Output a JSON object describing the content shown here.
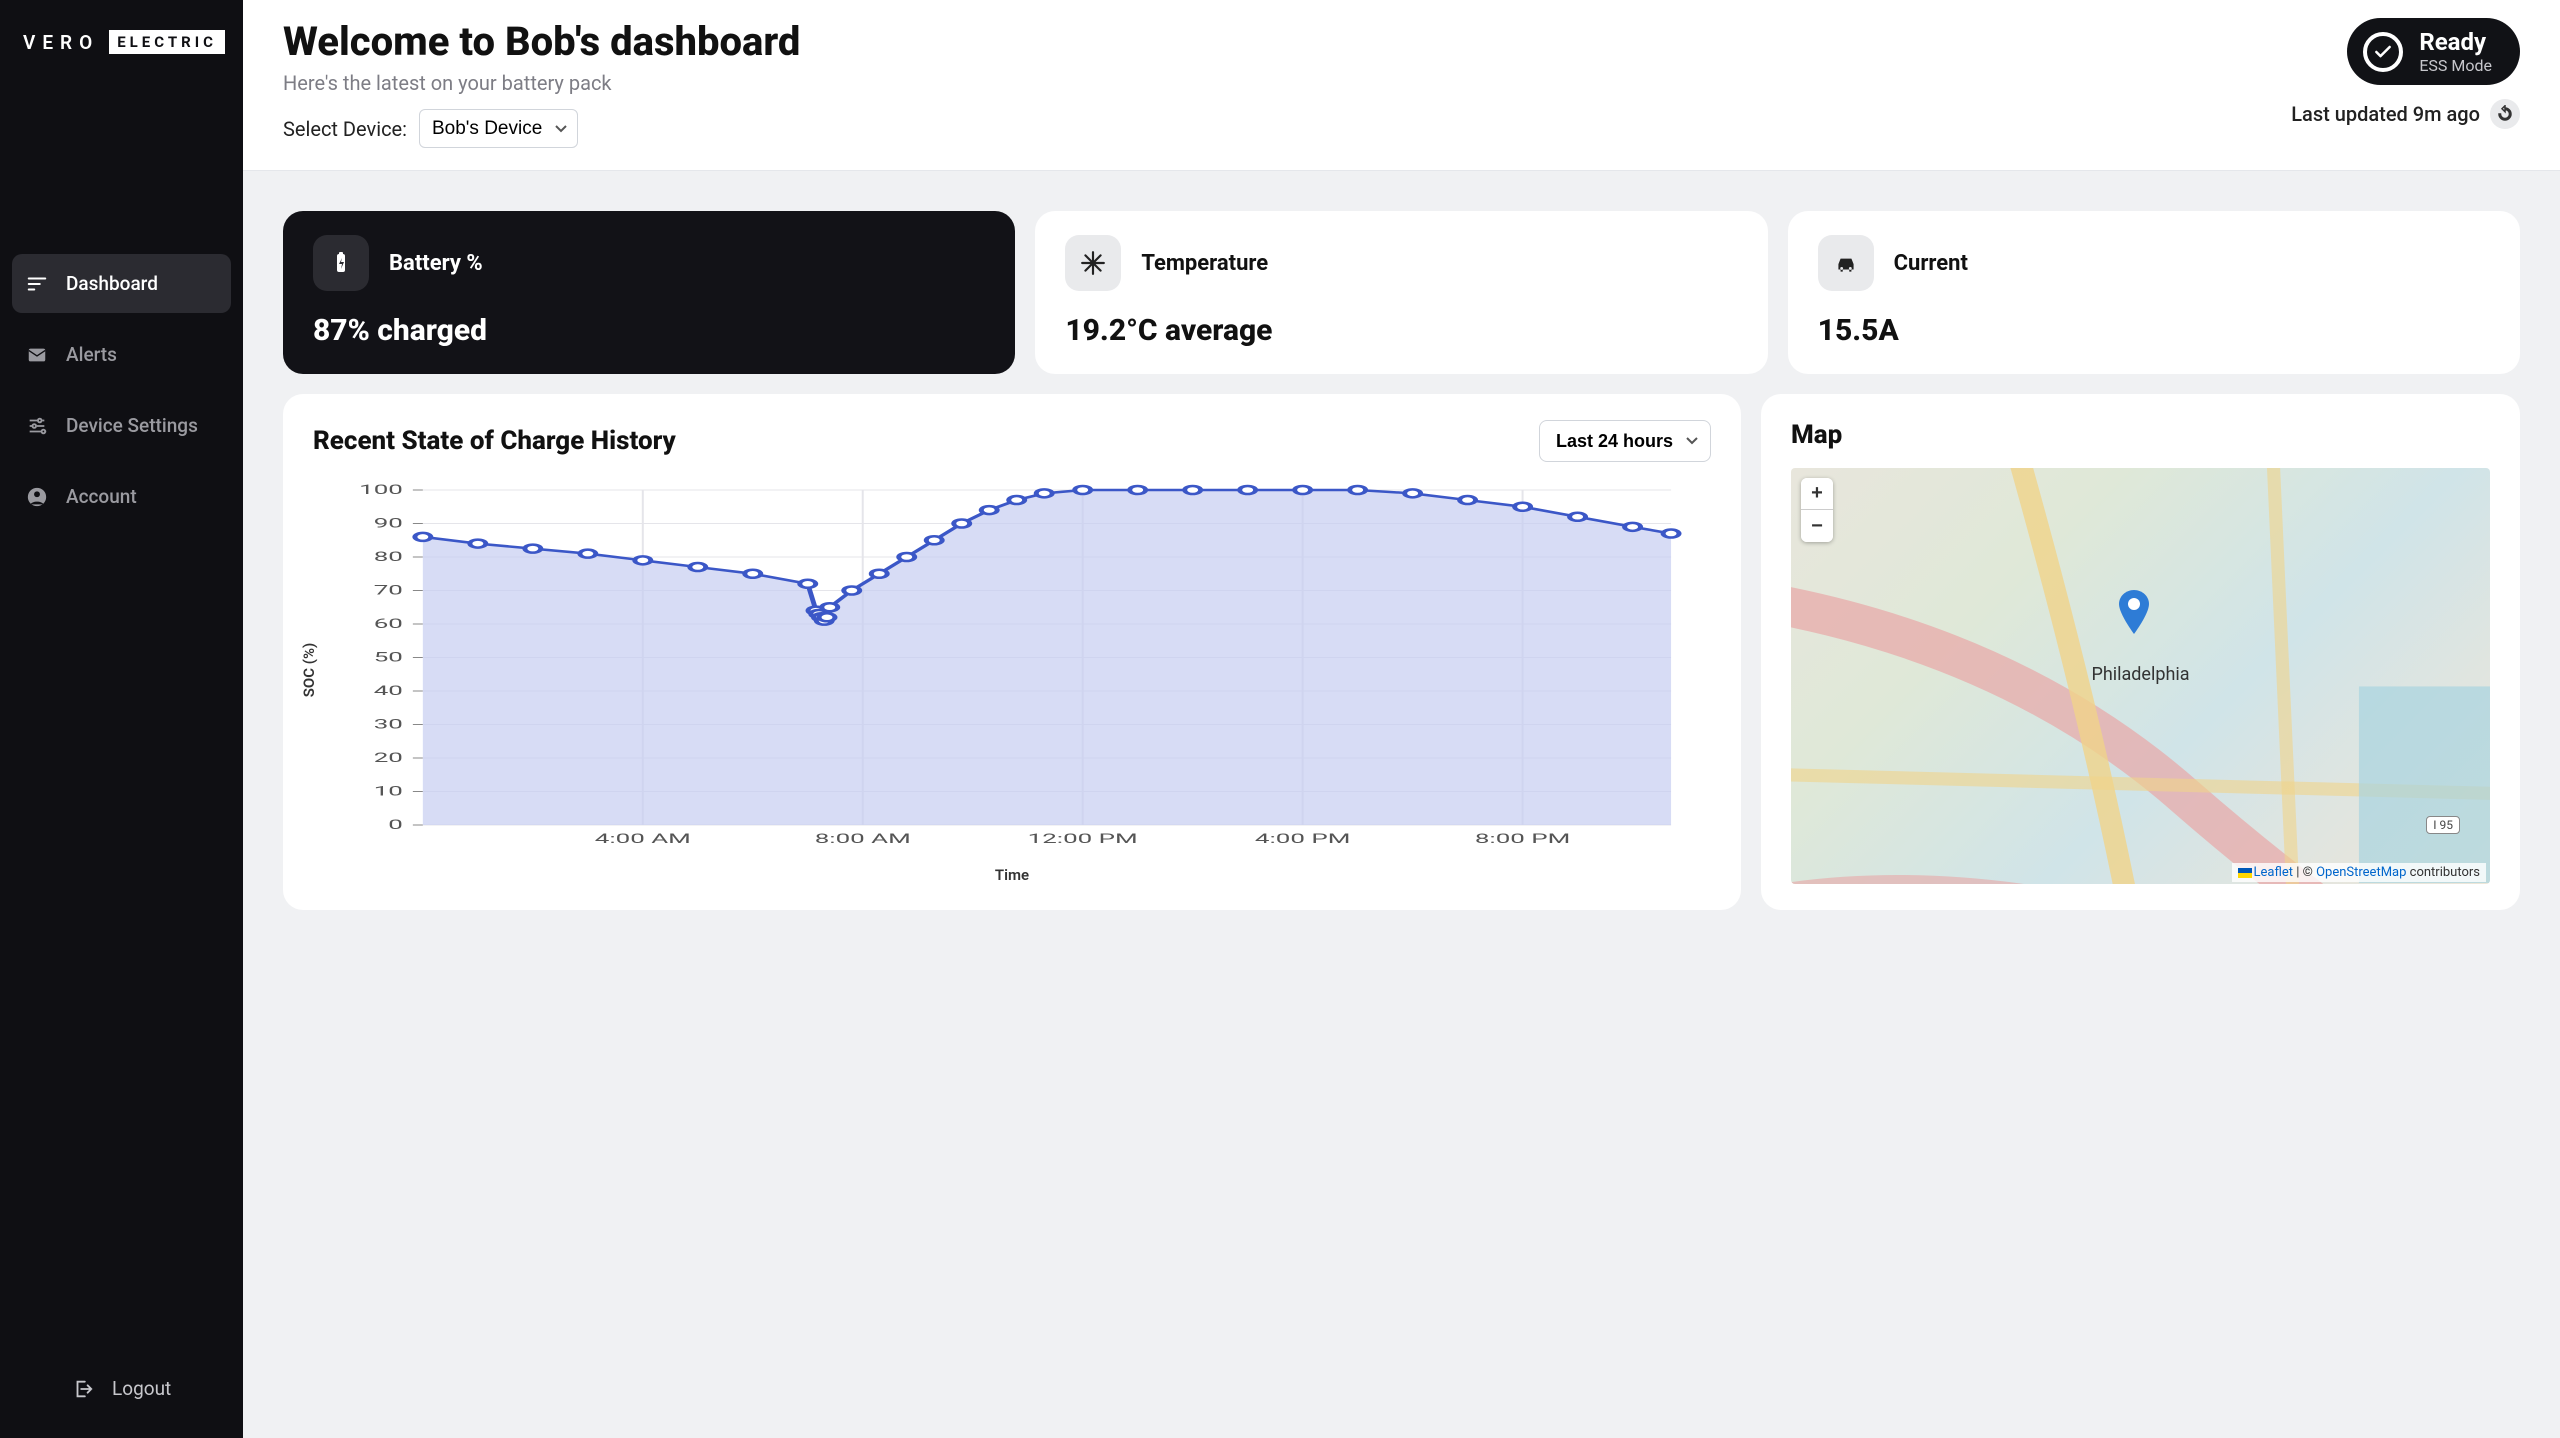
{
  "brand": {
    "text": "VERO",
    "badge": "ELECTRIC"
  },
  "sidebar": {
    "items": [
      {
        "label": "Dashboard",
        "icon": "sort-icon",
        "active": true
      },
      {
        "label": "Alerts",
        "icon": "mail-icon",
        "active": false
      },
      {
        "label": "Device Settings",
        "icon": "tune-icon",
        "active": false
      },
      {
        "label": "Account",
        "icon": "account-icon",
        "active": false
      }
    ],
    "logout": "Logout"
  },
  "header": {
    "title": "Welcome to Bob's dashboard",
    "subtitle": "Here's the latest on your battery pack",
    "device_label": "Select Device:",
    "device_selected": "Bob's Device",
    "status_title": "Ready",
    "status_sub": "ESS Mode",
    "updated": "Last updated 9m ago"
  },
  "cards": {
    "battery": {
      "title": "Battery %",
      "value": "87% charged"
    },
    "temperature": {
      "title": "Temperature",
      "value": "19.2°C average"
    },
    "current": {
      "title": "Current",
      "value": "15.5A"
    }
  },
  "chart_panel": {
    "title": "Recent State of Charge History",
    "range": "Last 24 hours"
  },
  "chart_data": {
    "type": "line",
    "title": "Recent State of Charge History",
    "xlabel": "Time",
    "ylabel": "SOC (%)",
    "ylim": [
      0,
      100
    ],
    "yticks": [
      0,
      10,
      20,
      30,
      40,
      50,
      60,
      70,
      80,
      90,
      100
    ],
    "xticks": [
      "4:00 AM",
      "8:00 AM",
      "12:00 PM",
      "4:00 PM",
      "8:00 PM"
    ],
    "x": [
      0,
      1,
      2,
      3,
      4,
      5,
      6,
      7,
      7.15,
      7.2,
      7.25,
      7.3,
      7.35,
      7.4,
      7.8,
      8.3,
      8.8,
      9.3,
      9.8,
      10.3,
      10.8,
      11.3,
      12,
      13,
      14,
      15,
      16,
      17,
      18,
      19,
      20,
      21,
      22,
      22.7
    ],
    "values": [
      86,
      84,
      82.5,
      81,
      79,
      77,
      75,
      72,
      64,
      63,
      62,
      61,
      62,
      65,
      70,
      75,
      80,
      85,
      90,
      94,
      97,
      99,
      100,
      100,
      100,
      100,
      100,
      100,
      99,
      97,
      95,
      92,
      89,
      87
    ]
  },
  "map_panel": {
    "title": "Map",
    "city": "Philadelphia",
    "badge": "I 95",
    "leaflet": "Leaflet",
    "osm": "OpenStreetMap",
    "osm_suffix": " contributors",
    "sep": " | © "
  }
}
